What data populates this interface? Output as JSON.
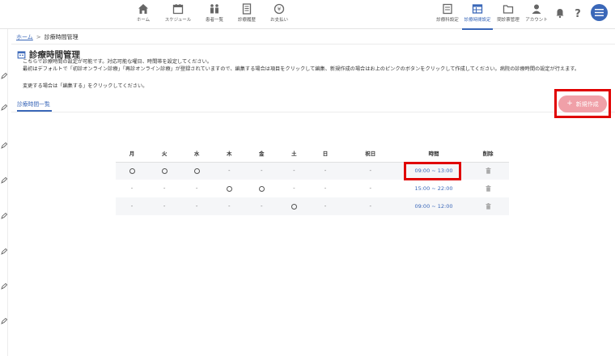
{
  "nav": {
    "items": [
      {
        "label": "ホーム",
        "icon": "home-icon"
      },
      {
        "label": "スケジュール",
        "icon": "calendar-icon"
      },
      {
        "label": "患者一覧",
        "icon": "patients-icon"
      },
      {
        "label": "診療履歴",
        "icon": "history-icon"
      },
      {
        "label": "お支払い",
        "icon": "payment-icon"
      }
    ],
    "right_items": [
      {
        "label": "診療科設定",
        "icon": "department-icon"
      },
      {
        "label": "診療時間設定",
        "icon": "clock-table-icon",
        "active": true
      },
      {
        "label": "問診票管理",
        "icon": "folder-icon"
      },
      {
        "label": "アカウント",
        "icon": "account-icon"
      }
    ],
    "accent_color": "#3a67b8"
  },
  "breadcrumb": {
    "home": "ホーム",
    "separator": ">",
    "current": "診療時間管理"
  },
  "page": {
    "title": "診療時間管理",
    "description_1": "こちらで診療時間の設定が可能です。対応可能な曜日、時間帯を設定してください。",
    "description_2": "最初はデフォルトで「初診オンライン診療」「再診オンライン診療」が登録されていますので、編集する場合は項目をクリックして編集、新規作成の場合はお上のピンクのボタンをクリックして作成してください。病院の診療時間の設定が行えます。",
    "description_3": "変更する場合は「編集する」をクリックしてください。",
    "tab_label": "診療時間一覧",
    "new_button_label": "新規作成"
  },
  "table": {
    "headers": [
      "月",
      "火",
      "水",
      "木",
      "金",
      "土",
      "日",
      "祝日",
      "時間",
      "削除"
    ],
    "rows": [
      {
        "days": [
          "○",
          "○",
          "○",
          "-",
          "-",
          "-",
          "-",
          "-"
        ],
        "time": "09:00 ~ 13:00"
      },
      {
        "days": [
          "-",
          "-",
          "-",
          "○",
          "○",
          "-",
          "-",
          "-"
        ],
        "time": "15:00 ~ 22:00"
      },
      {
        "days": [
          "-",
          "-",
          "-",
          "-",
          "-",
          "○",
          "-",
          "-"
        ],
        "time": "09:00 ~ 12:00"
      }
    ]
  },
  "colors": {
    "highlight": "#e00000",
    "new_button": "#f0a0a8",
    "link": "#3a67b8"
  }
}
